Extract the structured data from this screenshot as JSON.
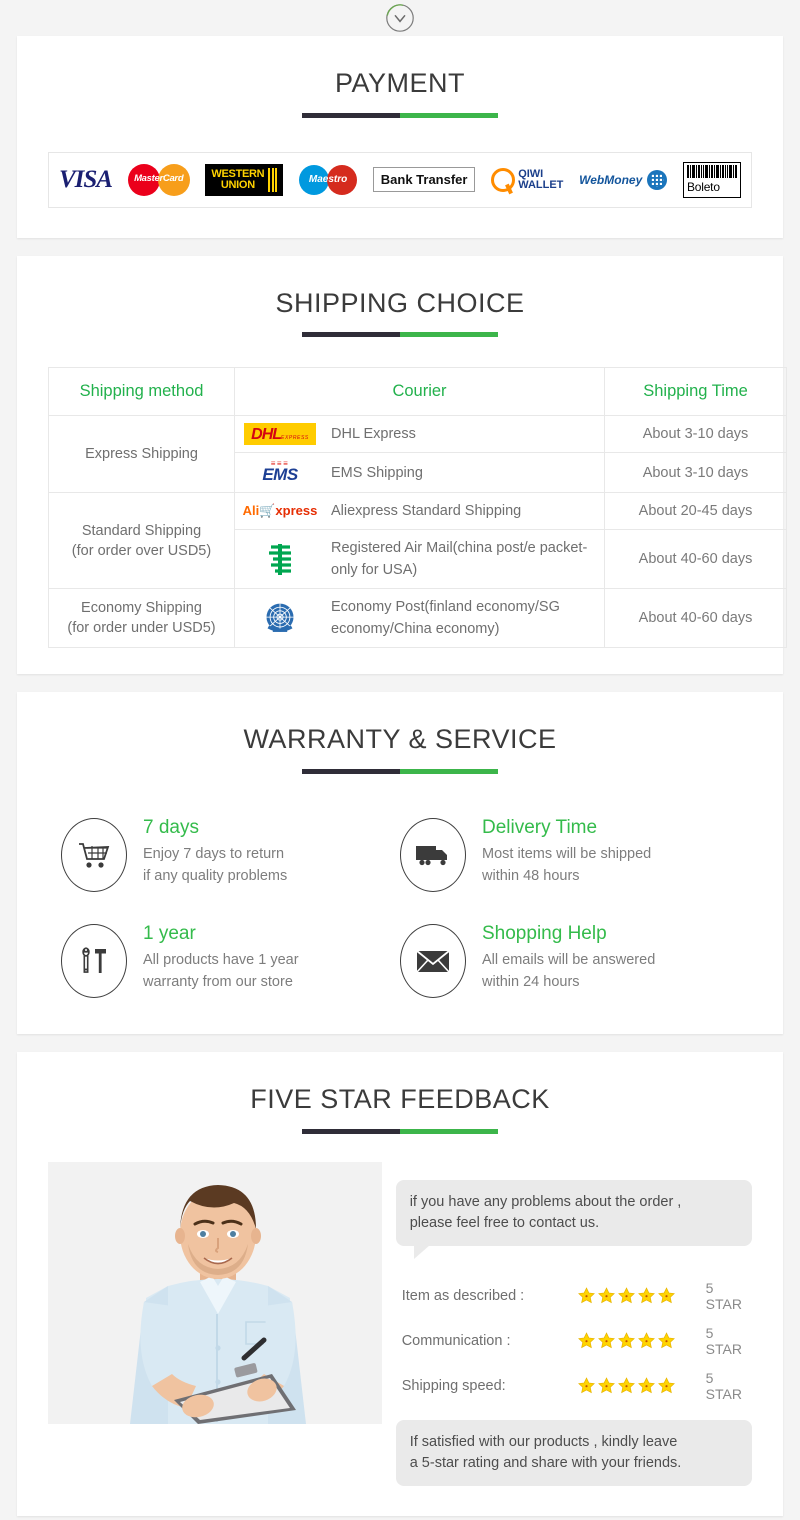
{
  "top": {
    "badge_icon": "chevron-down-circle-icon"
  },
  "payment": {
    "title": "PAYMENT",
    "methods": [
      {
        "name": "visa",
        "label": "VISA"
      },
      {
        "name": "mastercard",
        "label": "MasterCard"
      },
      {
        "name": "western-union",
        "label_line1": "WESTERN",
        "label_line2": "UNION"
      },
      {
        "name": "maestro",
        "label": "Maestro"
      },
      {
        "name": "bank-transfer",
        "label": "Bank Transfer"
      },
      {
        "name": "qiwi-wallet",
        "label_line1": "QIWI",
        "label_line2": "WALLET"
      },
      {
        "name": "webmoney",
        "label": "WebMoney"
      },
      {
        "name": "boleto",
        "label": "Boleto"
      }
    ]
  },
  "shipping": {
    "title": "SHIPPING CHOICE",
    "headers": [
      "Shipping method",
      "Courier",
      "Shipping Time"
    ],
    "groups": [
      {
        "method": "Express Shipping",
        "method_note": "",
        "rows": [
          {
            "logo": "dhl-logo",
            "courier": "DHL Express",
            "time": "About 3-10 days"
          },
          {
            "logo": "ems-logo",
            "courier": "EMS Shipping",
            "time": "About 3-10 days"
          }
        ]
      },
      {
        "method": "Standard Shipping",
        "method_note": "(for order over USD5)",
        "rows": [
          {
            "logo": "aliexpress-logo",
            "courier": "Aliexpress Standard Shipping",
            "time": "About 20-45 days"
          },
          {
            "logo": "china-post-logo",
            "courier": "Registered Air Mail(china post/e packet-only for USA)",
            "time": "About 40-60 days"
          }
        ]
      },
      {
        "method": "Economy Shipping",
        "method_note": "(for order under USD5)",
        "rows": [
          {
            "logo": "un-post-logo",
            "courier": "Economy Post(finland economy/SG economy/China economy)",
            "time": "About 40-60 days"
          }
        ]
      }
    ]
  },
  "warranty": {
    "title": "WARRANTY & SERVICE",
    "items": [
      {
        "icon": "shopping-cart-icon",
        "heading": "7 days",
        "line1": "Enjoy 7 days to return",
        "line2": "if any quality problems"
      },
      {
        "icon": "delivery-truck-icon",
        "heading": "Delivery Time",
        "line1": "Most items will be shipped",
        "line2": "within 48 hours"
      },
      {
        "icon": "tools-icon",
        "heading": "1 year",
        "line1": "All products have 1 year",
        "line2": "warranty from our store"
      },
      {
        "icon": "envelope-icon",
        "heading": "Shopping Help",
        "line1": "All emails will be answered",
        "line2": "within 24 hours"
      }
    ]
  },
  "feedback": {
    "title": "FIVE STAR FEEDBACK",
    "photo_alt": "smiling-man-with-clipboard-photo",
    "bubble_top_line1": "if you have any problems about the order ,",
    "bubble_top_line2": "please feel free to contact us.",
    "ratings": [
      {
        "label": "Item as described :",
        "stars": 5,
        "value": "5 STAR"
      },
      {
        "label": "Communication :",
        "stars": 5,
        "value": "5 STAR"
      },
      {
        "label": "Shipping speed:",
        "stars": 5,
        "value": "5 STAR"
      }
    ],
    "bubble_bottom_line1": "If satisfied with our products , kindly leave",
    "bubble_bottom_line2": "a 5-star rating and share with your friends."
  },
  "colors": {
    "green": "#3cb54a",
    "table_header_green": "#22b14c",
    "dark_rule": "#2f2d38",
    "text_gray": "#6f6f6f",
    "page_bg": "#f4f4f4"
  }
}
